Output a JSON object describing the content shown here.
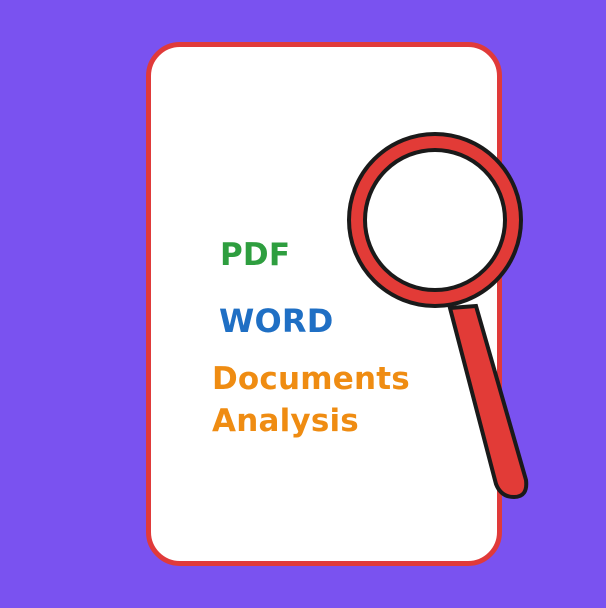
{
  "colors": {
    "background": "#7a52f0",
    "card_border": "#e03a3a",
    "card_fill": "#ffffff",
    "pdf_text": "#2e9e3f",
    "word_text": "#1f6fc4",
    "documents_text": "#ef8c12",
    "magnifier_red": "#e23b37",
    "magnifier_outline": "#1a1a1a"
  },
  "card": {
    "lines": {
      "pdf": "PDF",
      "word": "WORD",
      "documents": "Documents",
      "analysis": "Analysis"
    }
  },
  "icons": {
    "magnifier": "magnifying-glass-icon"
  }
}
